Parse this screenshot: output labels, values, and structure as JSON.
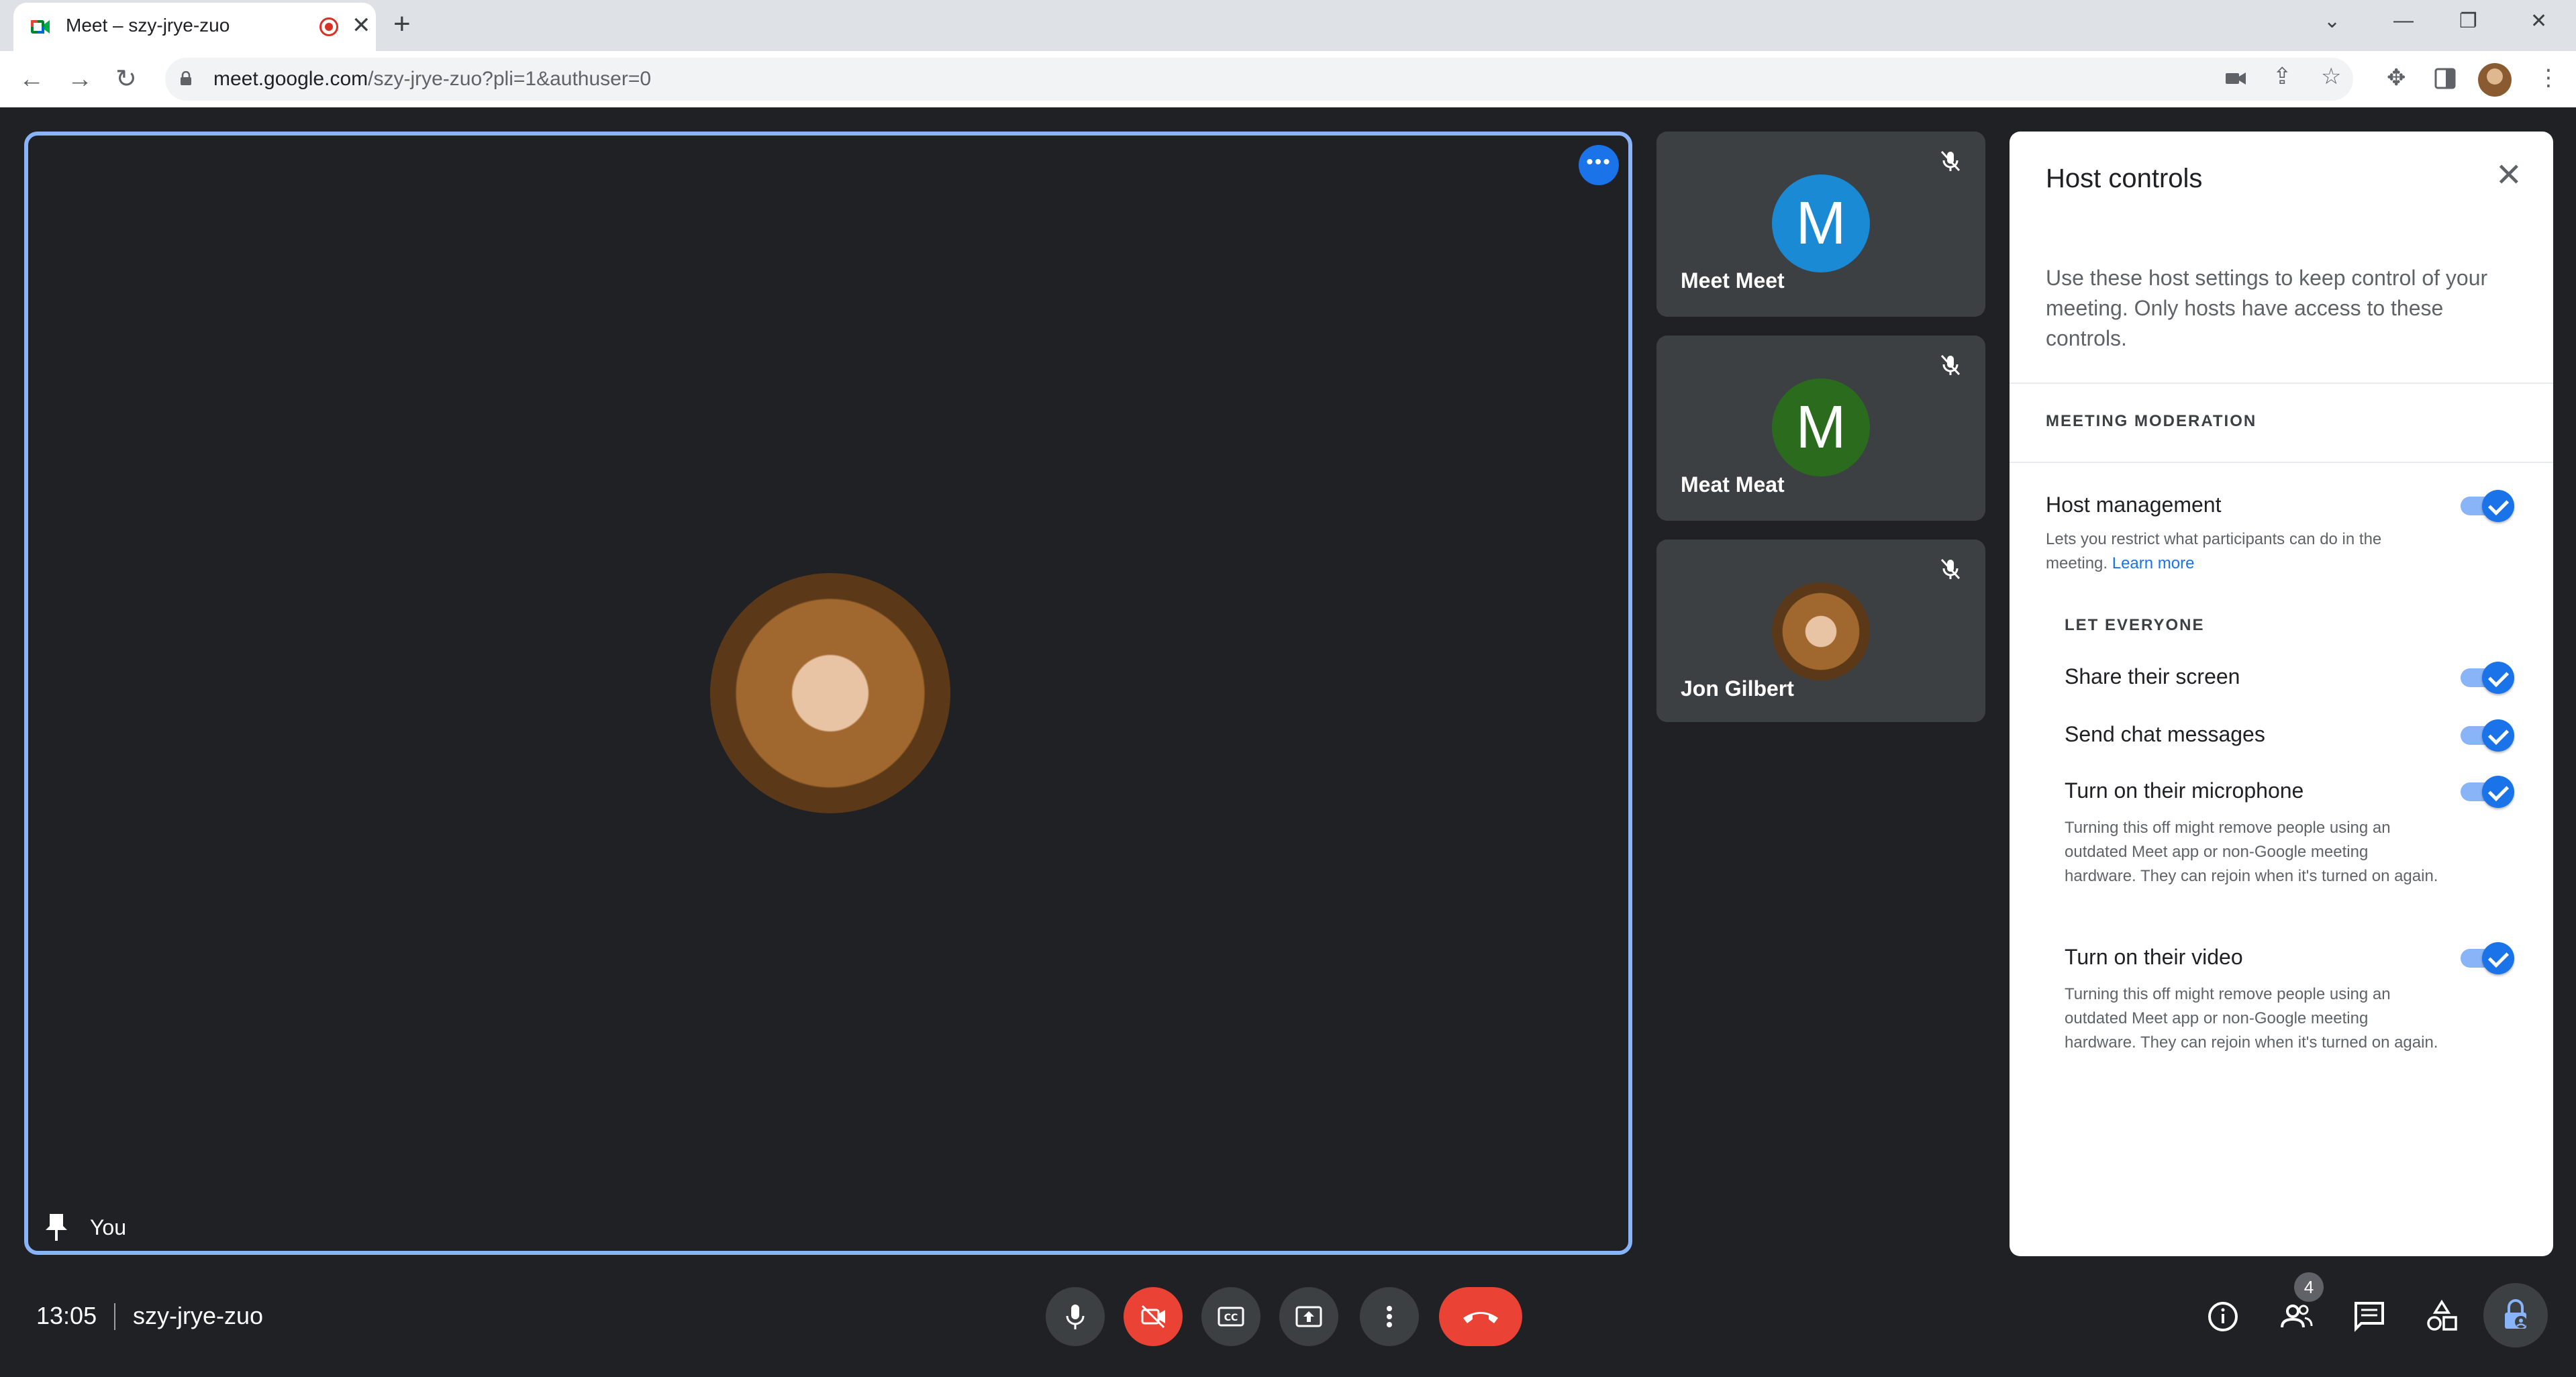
{
  "browser": {
    "tab_title": "Meet – szy-jrye-zuo",
    "url_host": "meet.google.com",
    "url_rest": "/szy-jrye-zuo?pli=1&authuser=0"
  },
  "stage": {
    "self_name": "You"
  },
  "participants": [
    {
      "name": "Meet Meet",
      "initial": "M",
      "color": "#1a8ad4"
    },
    {
      "name": "Meat Meat",
      "initial": "M",
      "color": "#2b6b1e"
    },
    {
      "name": "Jon Gilbert"
    }
  ],
  "host_controls": {
    "title": "Host controls",
    "description": "Use these host settings to keep control of your meeting. Only hosts have access to these controls.",
    "moderation_header": "MEETING MODERATION",
    "host_management": {
      "label": "Host management",
      "sub": "Lets you restrict what participants can do in the meeting.",
      "link": "Learn more",
      "on": true
    },
    "let_everyone_header": "LET EVERYONE",
    "options": [
      {
        "label": "Share their screen",
        "on": true
      },
      {
        "label": "Send chat messages",
        "on": true
      },
      {
        "label": "Turn on their microphone",
        "sub": "Turning this off might remove people using an outdated Meet app or non-Google meeting hardware. They can rejoin when it's turned on again.",
        "on": true
      },
      {
        "label": "Turn on their video",
        "sub": "Turning this off might remove people using an outdated Meet app or non-Google meeting hardware. They can rejoin when it's turned on again.",
        "on": true
      }
    ]
  },
  "bottom_bar": {
    "time": "13:05",
    "meeting_code": "szy-jrye-zuo",
    "people_count": "4"
  },
  "icons": [
    "meet-favicon",
    "record-icon",
    "close-icon",
    "plus-icon",
    "back-icon",
    "forward-icon",
    "reload-icon",
    "lock-icon",
    "camera-icon",
    "share-icon",
    "star-icon",
    "extensions-icon",
    "sidepanel-icon",
    "kebab-icon",
    "pin-icon",
    "mic-off-icon",
    "mic-icon",
    "camera-off-icon",
    "captions-icon",
    "present-icon",
    "more-vert-icon",
    "end-call-icon",
    "info-icon",
    "people-icon",
    "chat-icon",
    "activities-icon",
    "host-lock-icon"
  ]
}
